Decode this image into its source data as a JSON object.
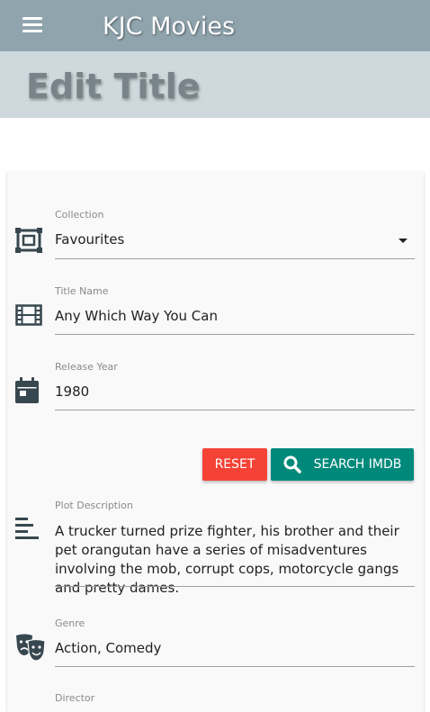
{
  "app": {
    "title": "KJC Movies"
  },
  "page": {
    "title": "Edit Title"
  },
  "form": {
    "collection": {
      "label": "Collection",
      "value": "Favourites"
    },
    "title_name": {
      "label": "Title Name",
      "value": "Any Which Way You Can"
    },
    "release_year": {
      "label": "Release Year",
      "value": "1980"
    },
    "plot_description": {
      "label": "Plot Description",
      "value": "A trucker turned prize fighter, his brother and their pet orangutan have a series of misadventures involving the mob, corrupt cops, motorcycle gangs and pretty dames."
    },
    "genre": {
      "label": "Genre",
      "value": "Action, Comedy"
    },
    "director": {
      "label": "Director"
    }
  },
  "buttons": {
    "reset_label": "RESET",
    "search_label": "SEARCH IMDB"
  },
  "colors": {
    "appbar": "#90a4ae",
    "header": "#cfd8dc",
    "reset": "#f44336",
    "search": "#00897b",
    "icon": "#37474f"
  },
  "icons": {
    "menu": "menu-icon",
    "collection": "collection-icon",
    "title": "film-icon",
    "year": "calendar-icon",
    "plot": "text-lines-icon",
    "genre": "theater-masks-icon",
    "search": "search-icon"
  }
}
